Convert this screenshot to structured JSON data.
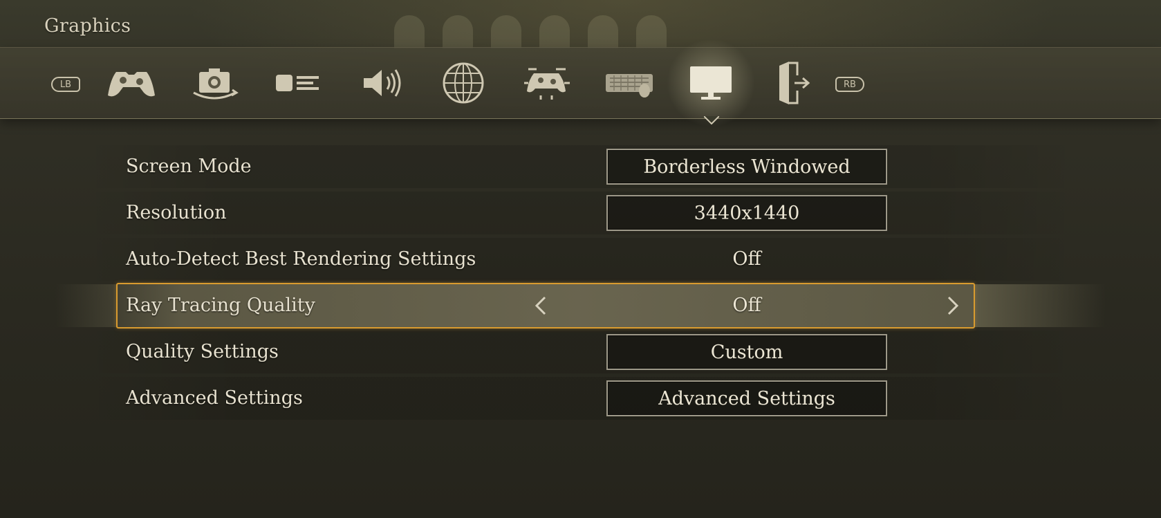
{
  "page": {
    "title": "Graphics"
  },
  "tabs": {
    "left_bumper": "LB",
    "right_bumper": "RB",
    "items": [
      {
        "icon": "controller-icon"
      },
      {
        "icon": "camera-icon"
      },
      {
        "icon": "display-bars-icon"
      },
      {
        "icon": "sound-icon"
      },
      {
        "icon": "globe-icon"
      },
      {
        "icon": "controller-layout-icon"
      },
      {
        "icon": "keyboard-mouse-icon"
      },
      {
        "icon": "monitor-icon",
        "active": true
      },
      {
        "icon": "exit-door-icon"
      }
    ]
  },
  "settings": [
    {
      "label": "Screen Mode",
      "value": "Borderless Windowed",
      "style": "box"
    },
    {
      "label": "Resolution",
      "value": "3440x1440",
      "style": "box"
    },
    {
      "label": "Auto-Detect Best Rendering Settings",
      "value": "Off",
      "style": "plain"
    },
    {
      "label": "Ray Tracing Quality",
      "value": "Off",
      "style": "selector",
      "selected": true
    },
    {
      "label": "Quality Settings",
      "value": "Custom",
      "style": "box"
    },
    {
      "label": "Advanced Settings",
      "value": "Advanced Settings",
      "style": "box"
    }
  ],
  "colors": {
    "highlight": "#d99b2f",
    "text": "#e8e2d0",
    "box_border": "#9e9989"
  }
}
